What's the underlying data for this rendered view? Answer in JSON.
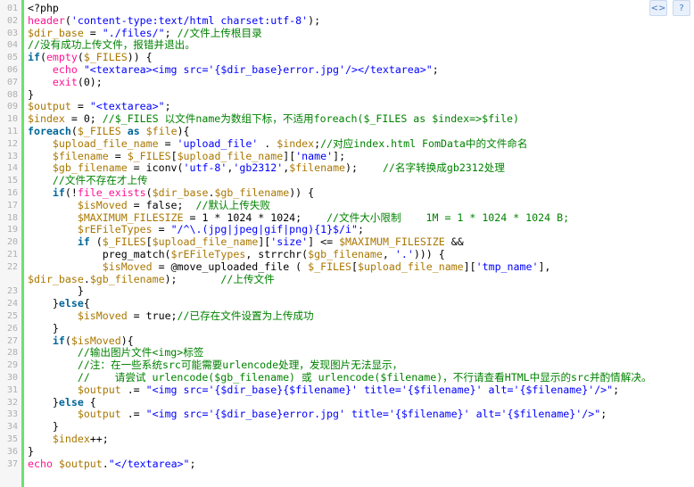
{
  "toolbar": {
    "view_source_icon": "<>",
    "help_icon": "?"
  },
  "lines": [
    {
      "n": "01",
      "t": [
        [
          "plain",
          "<?php"
        ]
      ]
    },
    {
      "n": "02",
      "t": [
        [
          "fn",
          "header"
        ],
        [
          "plain",
          "("
        ],
        [
          "str",
          "'content-type:text/html charset:utf-8'"
        ],
        [
          "plain",
          ");"
        ]
      ]
    },
    {
      "n": "03",
      "t": [
        [
          "var",
          "$dir_base"
        ],
        [
          "plain",
          " = "
        ],
        [
          "str",
          "\"./files/\""
        ],
        [
          "plain",
          "; "
        ],
        [
          "com",
          "//文件上传根目录"
        ]
      ]
    },
    {
      "n": "04",
      "t": [
        [
          "com",
          "//没有成功上传文件，报错并退出。"
        ]
      ]
    },
    {
      "n": "05",
      "t": [
        [
          "kw",
          "if"
        ],
        [
          "plain",
          "("
        ],
        [
          "fn",
          "empty"
        ],
        [
          "plain",
          "("
        ],
        [
          "var",
          "$_FILES"
        ],
        [
          "plain",
          ")) {"
        ]
      ]
    },
    {
      "n": "06",
      "t": [
        [
          "plain",
          "    "
        ],
        [
          "fn",
          "echo"
        ],
        [
          "plain",
          " "
        ],
        [
          "str",
          "\"<textarea><img src='{$dir_base}error.jpg'/></textarea>\""
        ],
        [
          "plain",
          ";"
        ]
      ]
    },
    {
      "n": "07",
      "t": [
        [
          "plain",
          "    "
        ],
        [
          "fn",
          "exit"
        ],
        [
          "plain",
          "(0);"
        ]
      ]
    },
    {
      "n": "08",
      "t": [
        [
          "plain",
          "}"
        ]
      ]
    },
    {
      "n": "09",
      "t": [
        [
          "var",
          "$output"
        ],
        [
          "plain",
          " = "
        ],
        [
          "str",
          "\"<textarea>\""
        ],
        [
          "plain",
          ";"
        ]
      ]
    },
    {
      "n": "10",
      "t": [
        [
          "var",
          "$index"
        ],
        [
          "plain",
          " = 0; "
        ],
        [
          "com",
          "//$_FILES 以文件name为数组下标，不适用foreach($_FILES as $index=>$file)"
        ]
      ]
    },
    {
      "n": "11",
      "t": [
        [
          "kw",
          "foreach"
        ],
        [
          "plain",
          "("
        ],
        [
          "var",
          "$_FILES"
        ],
        [
          "plain",
          " "
        ],
        [
          "kw",
          "as"
        ],
        [
          "plain",
          " "
        ],
        [
          "var",
          "$file"
        ],
        [
          "plain",
          "){"
        ]
      ]
    },
    {
      "n": "12",
      "t": [
        [
          "plain",
          "    "
        ],
        [
          "var",
          "$upload_file_name"
        ],
        [
          "plain",
          " = "
        ],
        [
          "str",
          "'upload_file'"
        ],
        [
          "plain",
          " . "
        ],
        [
          "var",
          "$index"
        ],
        [
          "plain",
          ";"
        ],
        [
          "com",
          "//对应index.html FomData中的文件命名"
        ]
      ]
    },
    {
      "n": "13",
      "t": [
        [
          "plain",
          "    "
        ],
        [
          "var",
          "$filename"
        ],
        [
          "plain",
          " = "
        ],
        [
          "var",
          "$_FILES"
        ],
        [
          "plain",
          "["
        ],
        [
          "var",
          "$upload_file_name"
        ],
        [
          "plain",
          "]["
        ],
        [
          "str",
          "'name'"
        ],
        [
          "plain",
          "];"
        ]
      ]
    },
    {
      "n": "14",
      "t": [
        [
          "plain",
          "    "
        ],
        [
          "var",
          "$gb_filename"
        ],
        [
          "plain",
          " = "
        ],
        [
          "plain",
          "iconv("
        ],
        [
          "str",
          "'utf-8'"
        ],
        [
          "plain",
          ","
        ],
        [
          "str",
          "'gb2312'"
        ],
        [
          "plain",
          ","
        ],
        [
          "var",
          "$filename"
        ],
        [
          "plain",
          ");    "
        ],
        [
          "com",
          "//名字转换成gb2312处理"
        ]
      ]
    },
    {
      "n": "15",
      "t": [
        [
          "plain",
          "    "
        ],
        [
          "com",
          "//文件不存在才上传"
        ]
      ]
    },
    {
      "n": "16",
      "t": [
        [
          "plain",
          "    "
        ],
        [
          "kw",
          "if"
        ],
        [
          "plain",
          "(!"
        ],
        [
          "fn",
          "file_exists"
        ],
        [
          "plain",
          "("
        ],
        [
          "var",
          "$dir_base"
        ],
        [
          "plain",
          "."
        ],
        [
          "var",
          "$gb_filename"
        ],
        [
          "plain",
          ")) {"
        ]
      ]
    },
    {
      "n": "17",
      "t": [
        [
          "plain",
          "        "
        ],
        [
          "var",
          "$isMoved"
        ],
        [
          "plain",
          " = "
        ],
        [
          "plain",
          "false;  "
        ],
        [
          "com",
          "//默认上传失败"
        ]
      ]
    },
    {
      "n": "18",
      "t": [
        [
          "plain",
          "        "
        ],
        [
          "var",
          "$MAXIMUM_FILESIZE"
        ],
        [
          "plain",
          " = 1 * 1024 * 1024;    "
        ],
        [
          "com",
          "//文件大小限制    1M = 1 * 1024 * 1024 B;"
        ]
      ]
    },
    {
      "n": "19",
      "t": [
        [
          "plain",
          "        "
        ],
        [
          "var",
          "$rEFileTypes"
        ],
        [
          "plain",
          " = "
        ],
        [
          "str",
          "\"/^\\.(jpg|jpeg|gif|png){1}$/i\""
        ],
        [
          "plain",
          ";"
        ]
      ]
    },
    {
      "n": "20",
      "t": [
        [
          "plain",
          "        "
        ],
        [
          "kw",
          "if"
        ],
        [
          "plain",
          " ("
        ],
        [
          "var",
          "$_FILES"
        ],
        [
          "plain",
          "["
        ],
        [
          "var",
          "$upload_file_name"
        ],
        [
          "plain",
          "]["
        ],
        [
          "str",
          "'size'"
        ],
        [
          "plain",
          "] <= "
        ],
        [
          "var",
          "$MAXIMUM_FILESIZE"
        ],
        [
          "plain",
          " &&"
        ]
      ]
    },
    {
      "n": "21",
      "t": [
        [
          "plain",
          "            preg_match("
        ],
        [
          "var",
          "$rEFileTypes"
        ],
        [
          "plain",
          ", strrchr("
        ],
        [
          "var",
          "$gb_filename"
        ],
        [
          "plain",
          ", "
        ],
        [
          "str",
          "'.'"
        ],
        [
          "plain",
          "))) {"
        ]
      ]
    },
    {
      "n": "22",
      "t": [
        [
          "plain",
          "            "
        ],
        [
          "var",
          "$isMoved"
        ],
        [
          "plain",
          " = @move_uploaded_file ( "
        ],
        [
          "var",
          "$_FILES"
        ],
        [
          "plain",
          "["
        ],
        [
          "var",
          "$upload_file_name"
        ],
        [
          "plain",
          "]["
        ],
        [
          "str",
          "'tmp_name'"
        ],
        [
          "plain",
          "],"
        ]
      ]
    },
    {
      "n": "",
      "t": [
        [
          "var",
          "$dir_base"
        ],
        [
          "plain",
          "."
        ],
        [
          "var",
          "$gb_filename"
        ],
        [
          "plain",
          ");       "
        ],
        [
          "com",
          "//上传文件"
        ]
      ]
    },
    {
      "n": "23",
      "t": [
        [
          "plain",
          "        }"
        ]
      ]
    },
    {
      "n": "24",
      "t": [
        [
          "plain",
          "    }"
        ],
        [
          "kw",
          "else"
        ],
        [
          "plain",
          "{"
        ]
      ]
    },
    {
      "n": "25",
      "t": [
        [
          "plain",
          "        "
        ],
        [
          "var",
          "$isMoved"
        ],
        [
          "plain",
          " = true;"
        ],
        [
          "com",
          "//已存在文件设置为上传成功"
        ]
      ]
    },
    {
      "n": "26",
      "t": [
        [
          "plain",
          "    }"
        ]
      ]
    },
    {
      "n": "27",
      "t": [
        [
          "plain",
          "    "
        ],
        [
          "kw",
          "if"
        ],
        [
          "plain",
          "("
        ],
        [
          "var",
          "$isMoved"
        ],
        [
          "plain",
          "){"
        ]
      ]
    },
    {
      "n": "28",
      "t": [
        [
          "plain",
          "        "
        ],
        [
          "com",
          "//输出图片文件<img>标签"
        ]
      ]
    },
    {
      "n": "29",
      "t": [
        [
          "plain",
          "        "
        ],
        [
          "com",
          "//注：在一些系统src可能需要urlencode处理，发现图片无法显示，"
        ]
      ]
    },
    {
      "n": "30",
      "t": [
        [
          "plain",
          "        "
        ],
        [
          "com",
          "//    请尝试 urlencode($gb_filename) 或 urlencode($filename)，不行请查看HTML中显示的src并酌情解决。"
        ]
      ]
    },
    {
      "n": "31",
      "t": [
        [
          "plain",
          "        "
        ],
        [
          "var",
          "$output"
        ],
        [
          "plain",
          " .= "
        ],
        [
          "str",
          "\"<img src='{$dir_base}{$filename}' title='{$filename}' alt='{$filename}'/>\""
        ],
        [
          "plain",
          ";"
        ]
      ]
    },
    {
      "n": "32",
      "t": [
        [
          "plain",
          "    }"
        ],
        [
          "kw",
          "else"
        ],
        [
          "plain",
          " {"
        ]
      ]
    },
    {
      "n": "33",
      "t": [
        [
          "plain",
          "        "
        ],
        [
          "var",
          "$output"
        ],
        [
          "plain",
          " .= "
        ],
        [
          "str",
          "\"<img src='{$dir_base}error.jpg' title='{$filename}' alt='{$filename}'/>\""
        ],
        [
          "plain",
          ";"
        ]
      ]
    },
    {
      "n": "34",
      "t": [
        [
          "plain",
          "    }"
        ]
      ]
    },
    {
      "n": "35",
      "t": [
        [
          "plain",
          "    "
        ],
        [
          "var",
          "$index"
        ],
        [
          "plain",
          "++;"
        ]
      ]
    },
    {
      "n": "36",
      "t": [
        [
          "plain",
          "}"
        ]
      ]
    },
    {
      "n": "37",
      "t": [
        [
          "fn",
          "echo"
        ],
        [
          "plain",
          " "
        ],
        [
          "var",
          "$output"
        ],
        [
          "plain",
          "."
        ],
        [
          "str",
          "\"</textarea>\""
        ],
        [
          "plain",
          ";"
        ]
      ]
    }
  ]
}
